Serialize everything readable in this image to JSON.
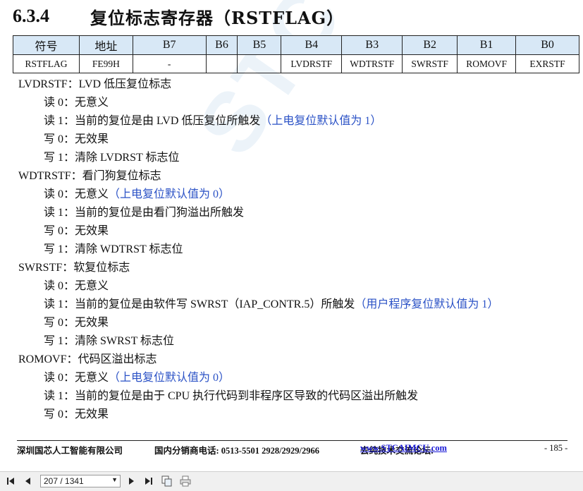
{
  "section": {
    "number": "6.3.4",
    "title": "复位标志寄存器（RSTFLAG）"
  },
  "watermark": "STC",
  "table": {
    "headers": [
      "符号",
      "地址",
      "B7",
      "B6",
      "B5",
      "B4",
      "B3",
      "B2",
      "B1",
      "B0"
    ],
    "row": [
      "RSTFLAG",
      "FE99H",
      "-",
      "",
      "",
      "LVDRSTF",
      "WDTRSTF",
      "SWRSTF",
      "ROMOVF",
      "EXRSTF"
    ]
  },
  "lines": [
    {
      "text": "LVDRSTF：LVD 低压复位标志",
      "note": ""
    },
    {
      "text": "读 0：无意义",
      "note": ""
    },
    {
      "text": "读 1：当前的复位是由 LVD 低压复位所触发",
      "note": "（上电复位默认值为 1）"
    },
    {
      "text": "写 0：无效果",
      "note": ""
    },
    {
      "text": "写 1：清除 LVDRST 标志位",
      "note": ""
    },
    {
      "text": "WDTRSTF：看门狗复位标志",
      "note": ""
    },
    {
      "text": "读 0：无意义",
      "note": "（上电复位默认值为 0）"
    },
    {
      "text": "读 1：当前的复位是由看门狗溢出所触发",
      "note": ""
    },
    {
      "text": "写 0：无效果",
      "note": ""
    },
    {
      "text": "写 1：清除 WDTRST 标志位",
      "note": ""
    },
    {
      "text": "SWRSTF：软复位标志",
      "note": ""
    },
    {
      "text": "读 0：无意义",
      "note": ""
    },
    {
      "text": "读 1：当前的复位是由软件写 SWRST（IAP_CONTR.5）所触发",
      "note": "（用户程序复位默认值为 1）"
    },
    {
      "text": "写 0：无效果",
      "note": ""
    },
    {
      "text": "写 1：清除 SWRST 标志位",
      "note": ""
    },
    {
      "text": "ROMOVF：代码区溢出标志",
      "note": ""
    },
    {
      "text": "读 0：无意义",
      "note": "（上电复位默认值为 0）"
    },
    {
      "text": "读 1：当前的复位是由于 CPU 执行代码到非程序区导致的代码区溢出所触发",
      "note": ""
    },
    {
      "text": "写 0：无效果",
      "note": ""
    }
  ],
  "footer": {
    "company": "深圳国芯人工智能有限公司",
    "phone": "国内分销商电话: 0513-5501 2928/2929/2966",
    "forum_label": "去纯技术交流论坛:",
    "forum_link": "www.STCAIMCU.com",
    "page": "- 185 -"
  },
  "viewer": {
    "page_indicator": "207 / 1341",
    "icons": [
      "first-page-icon",
      "prev-page-icon",
      "next-page-icon",
      "last-page-icon",
      "copy-icon",
      "print-icon"
    ]
  }
}
